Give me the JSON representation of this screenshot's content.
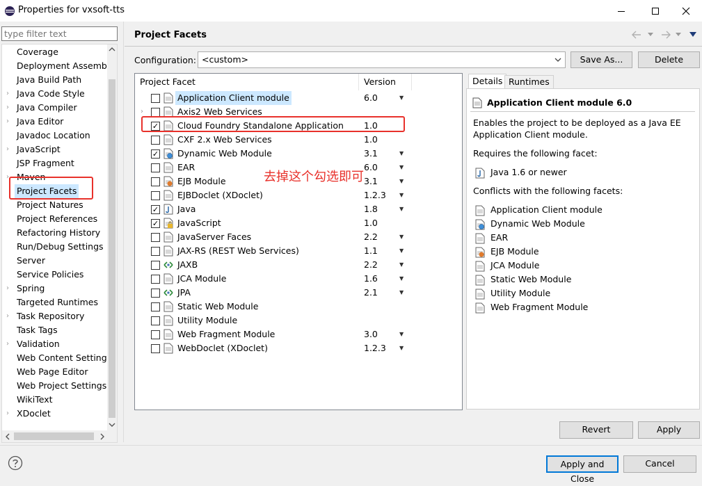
{
  "window": {
    "title": "Properties for vxsoft-tts"
  },
  "filter": {
    "placeholder": "type filter text"
  },
  "tree": {
    "items": [
      {
        "label": "Coverage",
        "arrow": ""
      },
      {
        "label": "Deployment Assembly",
        "arrow": ""
      },
      {
        "label": "Java Build Path",
        "arrow": ""
      },
      {
        "label": "Java Code Style",
        "arrow": "›"
      },
      {
        "label": "Java Compiler",
        "arrow": "›"
      },
      {
        "label": "Java Editor",
        "arrow": "›"
      },
      {
        "label": "Javadoc Location",
        "arrow": ""
      },
      {
        "label": "JavaScript",
        "arrow": "›"
      },
      {
        "label": "JSP Fragment",
        "arrow": ""
      },
      {
        "label": "Maven",
        "arrow": "›"
      },
      {
        "label": "Project Facets",
        "arrow": ""
      },
      {
        "label": "Project Natures",
        "arrow": ""
      },
      {
        "label": "Project References",
        "arrow": ""
      },
      {
        "label": "Refactoring History",
        "arrow": ""
      },
      {
        "label": "Run/Debug Settings",
        "arrow": ""
      },
      {
        "label": "Server",
        "arrow": ""
      },
      {
        "label": "Service Policies",
        "arrow": ""
      },
      {
        "label": "Spring",
        "arrow": "›"
      },
      {
        "label": "Targeted Runtimes",
        "arrow": ""
      },
      {
        "label": "Task Repository",
        "arrow": "›"
      },
      {
        "label": "Task Tags",
        "arrow": ""
      },
      {
        "label": "Validation",
        "arrow": "›"
      },
      {
        "label": "Web Content Settings",
        "arrow": ""
      },
      {
        "label": "Web Page Editor",
        "arrow": ""
      },
      {
        "label": "Web Project Settings",
        "arrow": ""
      },
      {
        "label": "WikiText",
        "arrow": ""
      },
      {
        "label": "XDoclet",
        "arrow": "›"
      }
    ]
  },
  "page": {
    "title": "Project Facets",
    "config_label": "Configuration:",
    "config_value": "<custom>",
    "save_as": "Save As...",
    "delete": "Delete"
  },
  "facets": {
    "col_facet": "Project Facet",
    "col_version": "Version",
    "rows": [
      {
        "name": "Application Client module",
        "version": "6.0",
        "checked": false,
        "dropdown": true,
        "expander": false
      },
      {
        "name": "Axis2 Web Services",
        "version": "",
        "checked": false,
        "dropdown": false,
        "expander": true
      },
      {
        "name": "Cloud Foundry Standalone Application",
        "version": "1.0",
        "checked": true,
        "dropdown": false,
        "expander": false
      },
      {
        "name": "CXF 2.x Web Services",
        "version": "1.0",
        "checked": false,
        "dropdown": false,
        "expander": false
      },
      {
        "name": "Dynamic Web Module",
        "version": "3.1",
        "checked": true,
        "dropdown": true,
        "expander": false
      },
      {
        "name": "EAR",
        "version": "6.0",
        "checked": false,
        "dropdown": true,
        "expander": false
      },
      {
        "name": "EJB Module",
        "version": "3.1",
        "checked": false,
        "dropdown": true,
        "expander": false
      },
      {
        "name": "EJBDoclet (XDoclet)",
        "version": "1.2.3",
        "checked": false,
        "dropdown": true,
        "expander": false
      },
      {
        "name": "Java",
        "version": "1.8",
        "checked": true,
        "dropdown": true,
        "expander": false
      },
      {
        "name": "JavaScript",
        "version": "1.0",
        "checked": true,
        "dropdown": false,
        "expander": false
      },
      {
        "name": "JavaServer Faces",
        "version": "2.2",
        "checked": false,
        "dropdown": true,
        "expander": false
      },
      {
        "name": "JAX-RS (REST Web Services)",
        "version": "1.1",
        "checked": false,
        "dropdown": true,
        "expander": false
      },
      {
        "name": "JAXB",
        "version": "2.2",
        "checked": false,
        "dropdown": true,
        "expander": false
      },
      {
        "name": "JCA Module",
        "version": "1.6",
        "checked": false,
        "dropdown": true,
        "expander": false
      },
      {
        "name": "JPA",
        "version": "2.1",
        "checked": false,
        "dropdown": true,
        "expander": false
      },
      {
        "name": "Static Web Module",
        "version": "",
        "checked": false,
        "dropdown": false,
        "expander": false
      },
      {
        "name": "Utility Module",
        "version": "",
        "checked": false,
        "dropdown": false,
        "expander": false
      },
      {
        "name": "Web Fragment Module",
        "version": "3.0",
        "checked": false,
        "dropdown": true,
        "expander": false
      },
      {
        "name": "WebDoclet (XDoclet)",
        "version": "1.2.3",
        "checked": false,
        "dropdown": true,
        "expander": false
      }
    ]
  },
  "annotation": "去掉这个勾选即可",
  "details": {
    "tab_details": "Details",
    "tab_runtimes": "Runtimes",
    "heading": "Application Client module 6.0",
    "description_line1": "Enables the project to be deployed as a Java EE",
    "description_line2": "Application Client module.",
    "requires_label": "Requires the following facet:",
    "requires": [
      "Java 1.6 or newer"
    ],
    "conflicts_label": "Conflicts with the following facets:",
    "conflicts": [
      "Application Client module",
      "Dynamic Web Module",
      "EAR",
      "EJB Module",
      "JCA Module",
      "Static Web Module",
      "Utility Module",
      "Web Fragment Module"
    ]
  },
  "buttons": {
    "revert": "Revert",
    "apply": "Apply",
    "apply_close": "Apply and Close",
    "cancel": "Cancel"
  },
  "colors": {
    "accent_red": "#e8312b",
    "selection": "#cce8ff",
    "default_button_border": "#0078d7"
  }
}
